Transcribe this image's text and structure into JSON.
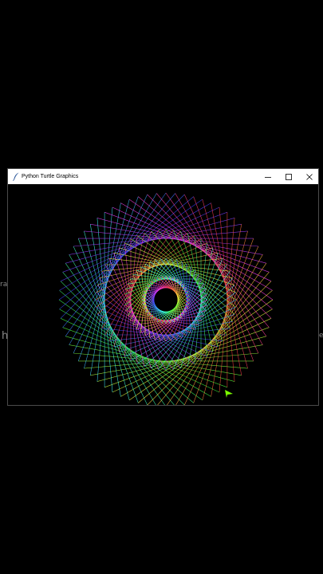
{
  "window": {
    "title": "Python Turtle Graphics",
    "controls": {
      "minimize_icon": "minimize-icon",
      "maximize_icon": "maximize-icon",
      "close_icon": "close-icon"
    }
  },
  "canvas": {
    "background": "#000000",
    "drawing": "spirograph-pattern",
    "turtle_color": "#7CFC00"
  },
  "background_edge_glyphs": {
    "left_upper": "ra",
    "left_lower": "h",
    "right_lower": "e"
  }
}
